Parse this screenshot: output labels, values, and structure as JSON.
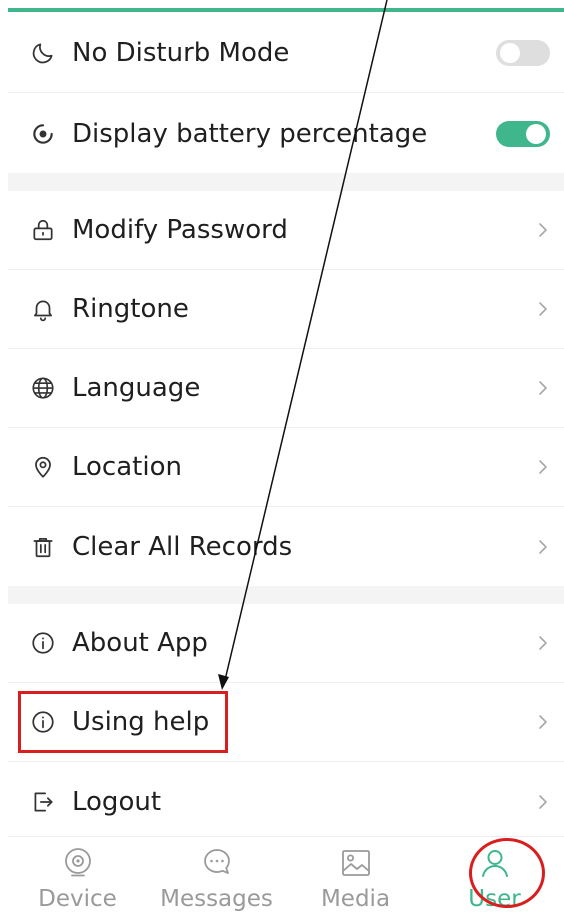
{
  "settings": {
    "group1": [
      {
        "label": "No Disturb Mode",
        "icon": "moon-icon",
        "control": "toggle",
        "enabled": false
      },
      {
        "label": "Display battery percentage",
        "icon": "battery-circle-icon",
        "control": "toggle",
        "enabled": true
      }
    ],
    "group2": [
      {
        "label": "Modify Password",
        "icon": "lock-icon"
      },
      {
        "label": "Ringtone",
        "icon": "bell-icon"
      },
      {
        "label": "Language",
        "icon": "globe-icon"
      },
      {
        "label": "Location",
        "icon": "location-pin-icon"
      },
      {
        "label": "Clear All Records",
        "icon": "trash-icon"
      }
    ],
    "group3": [
      {
        "label": "About App",
        "icon": "info-icon"
      },
      {
        "label": "Using help",
        "icon": "info-icon"
      },
      {
        "label": "Logout",
        "icon": "logout-icon"
      }
    ]
  },
  "tabbar": {
    "tabs": [
      {
        "label": "Device",
        "icon": "device-icon",
        "active": false
      },
      {
        "label": "Messages",
        "icon": "chat-bubble-icon",
        "active": false
      },
      {
        "label": "Media",
        "icon": "image-icon",
        "active": false
      },
      {
        "label": "User",
        "icon": "user-icon",
        "active": true
      }
    ]
  },
  "colors": {
    "accent": "#3fb68b",
    "annotation": "#d81e1e",
    "toggle_off": "#dedede",
    "section_gap": "#f4f4f4"
  }
}
